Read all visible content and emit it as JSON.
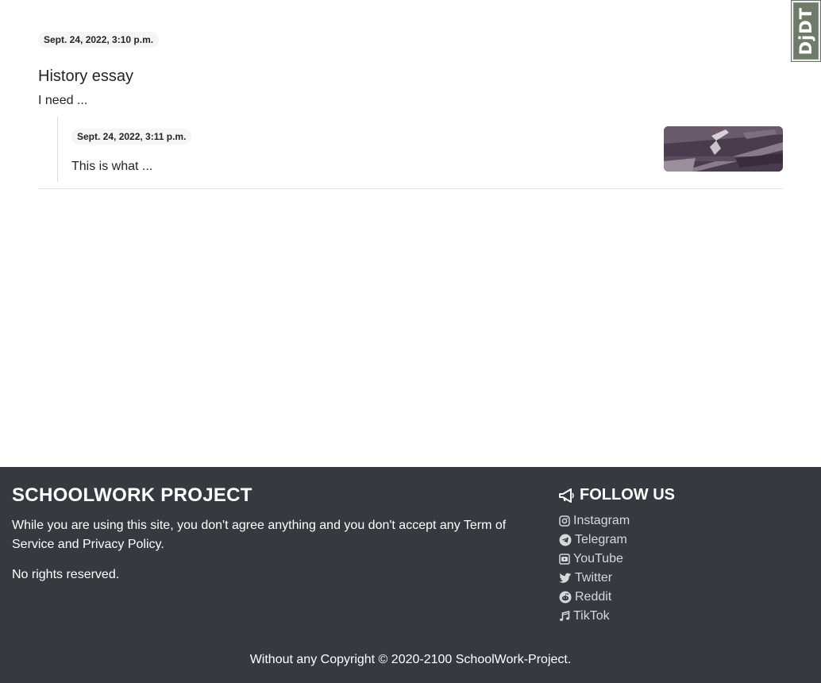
{
  "toolbar": {
    "label": "DjDT"
  },
  "post": {
    "date": "Sept. 24, 2022, 3:10 p.m.",
    "title": "History essay",
    "body": "I need ..."
  },
  "reply": {
    "date": "Sept. 24, 2022, 3:11 p.m.",
    "body": "This is what ..."
  },
  "footer": {
    "title": "SCHOOLWORK PROJECT",
    "disclaimer": "While you are using this site, you don't agree anything and you don't accept any Term of Service and Privacy Policy.",
    "rights": "No rights reserved.",
    "follow_title": "FOLLOW US",
    "social": [
      {
        "label": "Instagram",
        "icon": "instagram-icon"
      },
      {
        "label": "Telegram",
        "icon": "telegram-icon"
      },
      {
        "label": "YouTube",
        "icon": "youtube-icon"
      },
      {
        "label": "Twitter",
        "icon": "twitter-icon"
      },
      {
        "label": "Reddit",
        "icon": "reddit-icon"
      },
      {
        "label": "TikTok",
        "icon": "music-note-icon"
      }
    ],
    "copyright": "Without any Copyright © 2020-2100 SchoolWork-Project."
  }
}
